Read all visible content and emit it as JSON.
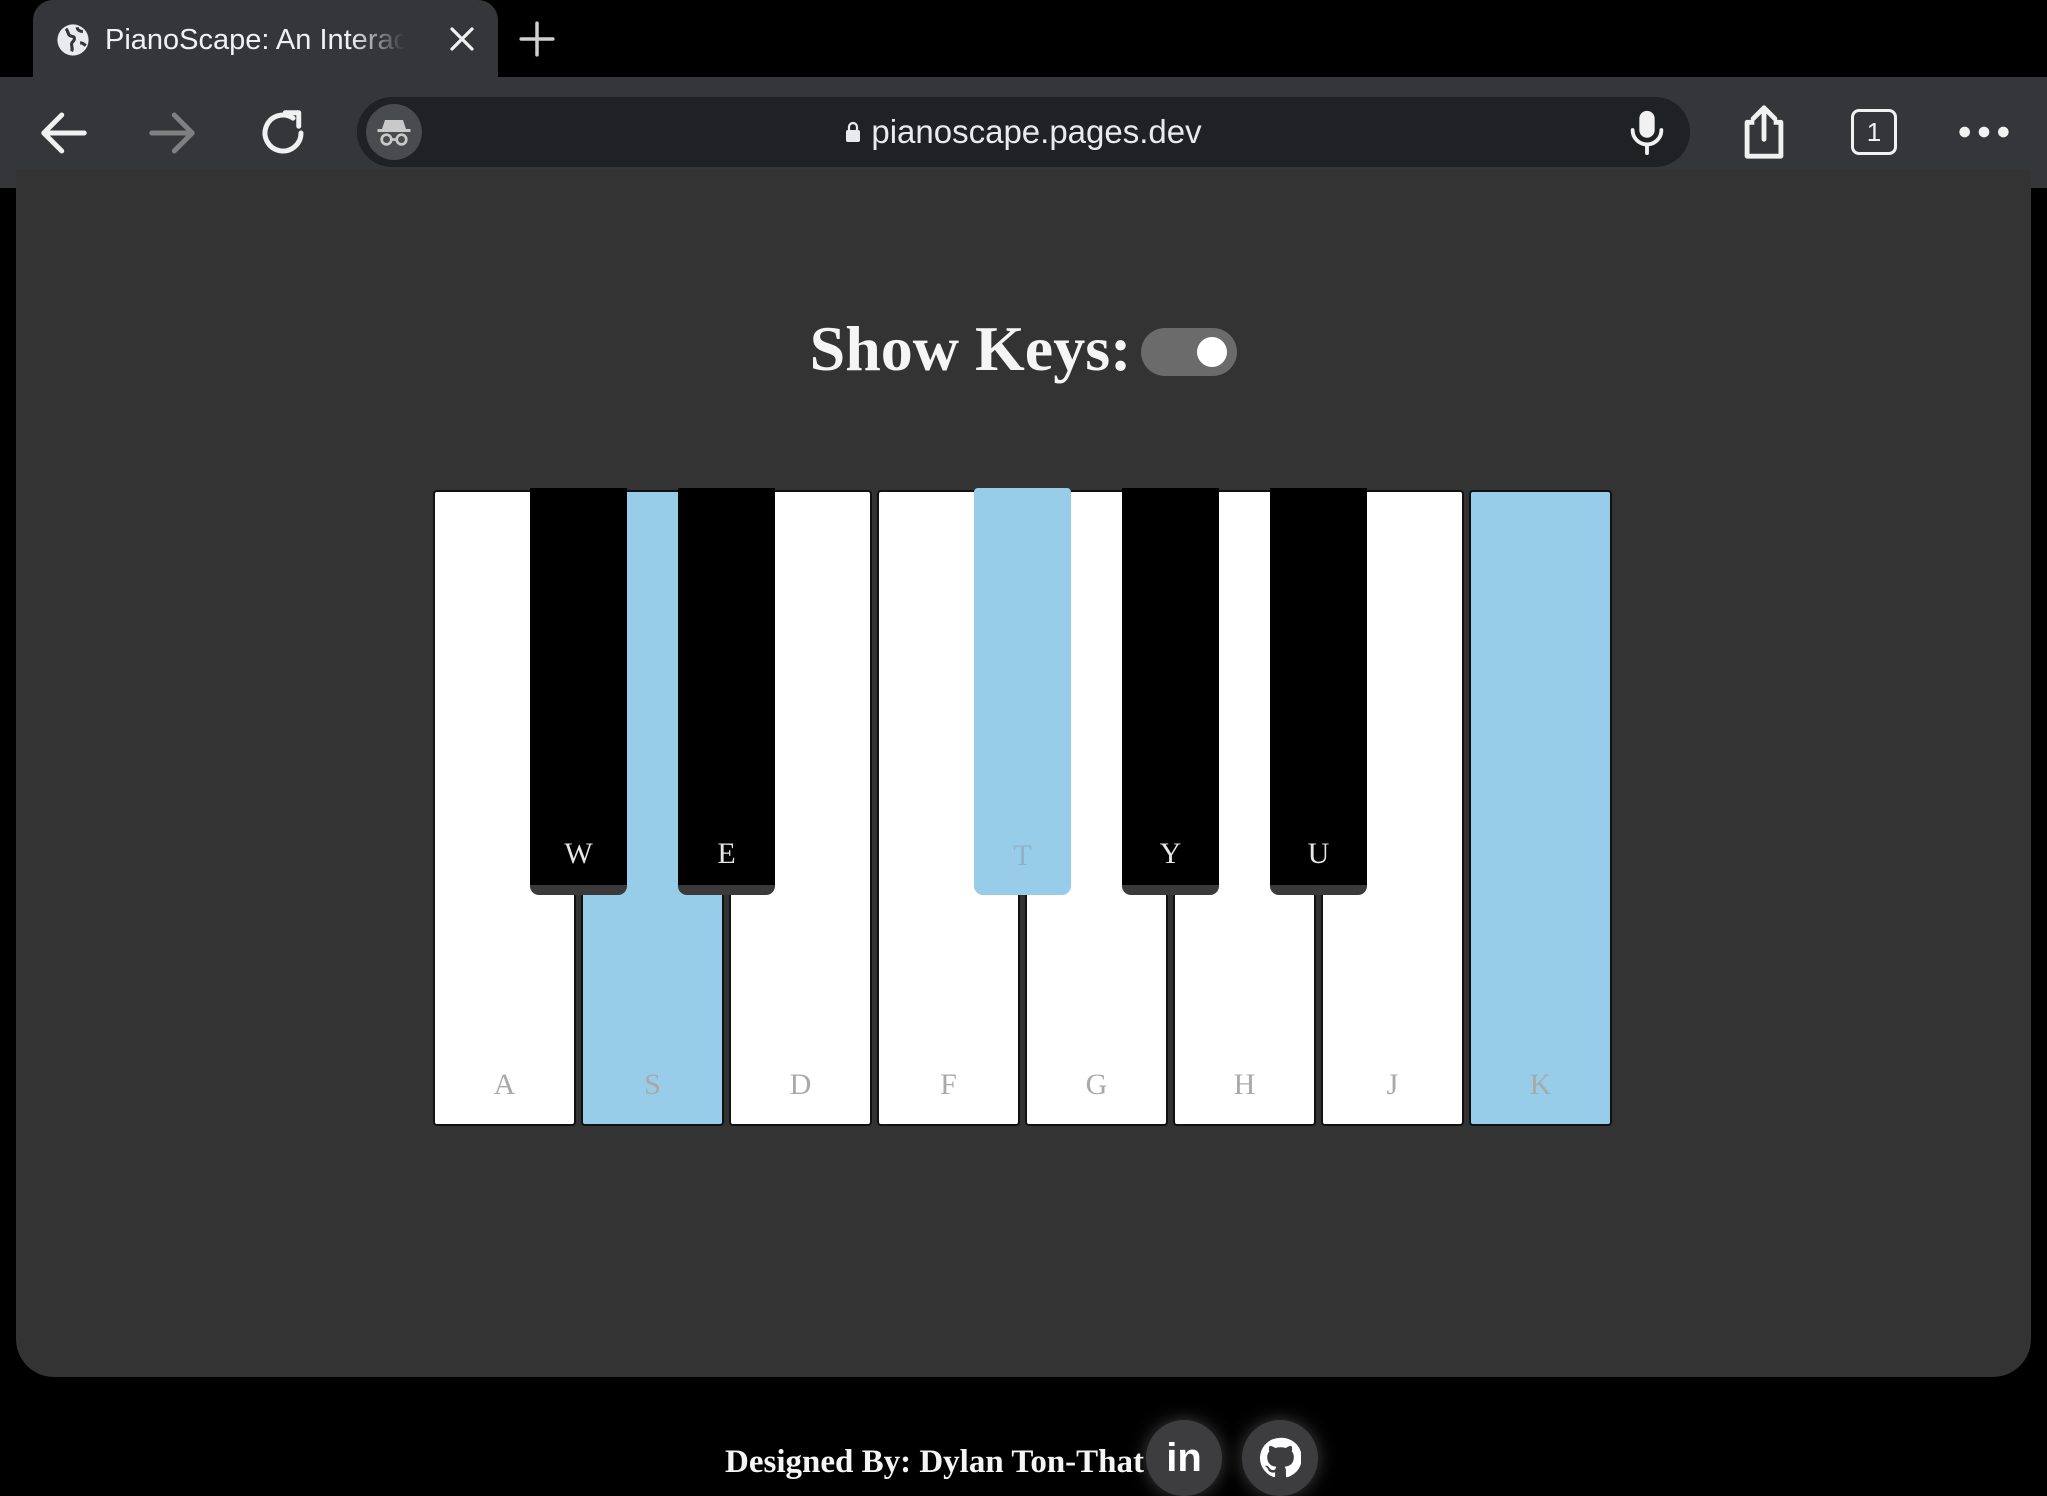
{
  "browser": {
    "tab_title": "PianoScape: An Interactive Piano",
    "url": "pianoscape.pages.dev",
    "tab_count": "1"
  },
  "page": {
    "show_keys_label": "Show Keys:",
    "show_keys_enabled": true,
    "white_keys": [
      {
        "key": "A",
        "active": false
      },
      {
        "key": "S",
        "active": true
      },
      {
        "key": "D",
        "active": false
      },
      {
        "key": "F",
        "active": false
      },
      {
        "key": "G",
        "active": false
      },
      {
        "key": "H",
        "active": false
      },
      {
        "key": "J",
        "active": false
      },
      {
        "key": "K",
        "active": true
      }
    ],
    "black_keys": [
      {
        "key": "W",
        "active": false
      },
      {
        "key": "E",
        "active": false
      },
      {
        "key": "T",
        "active": true
      },
      {
        "key": "Y",
        "active": false
      },
      {
        "key": "U",
        "active": false
      }
    ],
    "active_color": "#97cde8"
  },
  "footer": {
    "credit": "Designed By: Dylan Ton-That",
    "linkedin_label": "in",
    "linkedin_icon": "linkedin-icon",
    "github_icon": "github-icon"
  }
}
